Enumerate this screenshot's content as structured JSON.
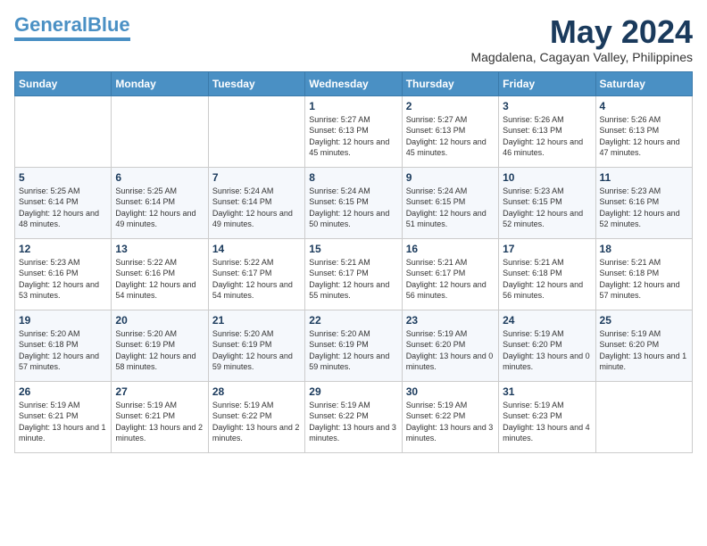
{
  "header": {
    "logo_general": "General",
    "logo_blue": "Blue",
    "month_year": "May 2024",
    "location": "Magdalena, Cagayan Valley, Philippines"
  },
  "weekdays": [
    "Sunday",
    "Monday",
    "Tuesday",
    "Wednesday",
    "Thursday",
    "Friday",
    "Saturday"
  ],
  "weeks": [
    [
      {
        "day": "",
        "info": ""
      },
      {
        "day": "",
        "info": ""
      },
      {
        "day": "",
        "info": ""
      },
      {
        "day": "1",
        "info": "Sunrise: 5:27 AM\nSunset: 6:13 PM\nDaylight: 12 hours\nand 45 minutes."
      },
      {
        "day": "2",
        "info": "Sunrise: 5:27 AM\nSunset: 6:13 PM\nDaylight: 12 hours\nand 45 minutes."
      },
      {
        "day": "3",
        "info": "Sunrise: 5:26 AM\nSunset: 6:13 PM\nDaylight: 12 hours\nand 46 minutes."
      },
      {
        "day": "4",
        "info": "Sunrise: 5:26 AM\nSunset: 6:13 PM\nDaylight: 12 hours\nand 47 minutes."
      }
    ],
    [
      {
        "day": "5",
        "info": "Sunrise: 5:25 AM\nSunset: 6:14 PM\nDaylight: 12 hours\nand 48 minutes."
      },
      {
        "day": "6",
        "info": "Sunrise: 5:25 AM\nSunset: 6:14 PM\nDaylight: 12 hours\nand 49 minutes."
      },
      {
        "day": "7",
        "info": "Sunrise: 5:24 AM\nSunset: 6:14 PM\nDaylight: 12 hours\nand 49 minutes."
      },
      {
        "day": "8",
        "info": "Sunrise: 5:24 AM\nSunset: 6:15 PM\nDaylight: 12 hours\nand 50 minutes."
      },
      {
        "day": "9",
        "info": "Sunrise: 5:24 AM\nSunset: 6:15 PM\nDaylight: 12 hours\nand 51 minutes."
      },
      {
        "day": "10",
        "info": "Sunrise: 5:23 AM\nSunset: 6:15 PM\nDaylight: 12 hours\nand 52 minutes."
      },
      {
        "day": "11",
        "info": "Sunrise: 5:23 AM\nSunset: 6:16 PM\nDaylight: 12 hours\nand 52 minutes."
      }
    ],
    [
      {
        "day": "12",
        "info": "Sunrise: 5:23 AM\nSunset: 6:16 PM\nDaylight: 12 hours\nand 53 minutes."
      },
      {
        "day": "13",
        "info": "Sunrise: 5:22 AM\nSunset: 6:16 PM\nDaylight: 12 hours\nand 54 minutes."
      },
      {
        "day": "14",
        "info": "Sunrise: 5:22 AM\nSunset: 6:17 PM\nDaylight: 12 hours\nand 54 minutes."
      },
      {
        "day": "15",
        "info": "Sunrise: 5:21 AM\nSunset: 6:17 PM\nDaylight: 12 hours\nand 55 minutes."
      },
      {
        "day": "16",
        "info": "Sunrise: 5:21 AM\nSunset: 6:17 PM\nDaylight: 12 hours\nand 56 minutes."
      },
      {
        "day": "17",
        "info": "Sunrise: 5:21 AM\nSunset: 6:18 PM\nDaylight: 12 hours\nand 56 minutes."
      },
      {
        "day": "18",
        "info": "Sunrise: 5:21 AM\nSunset: 6:18 PM\nDaylight: 12 hours\nand 57 minutes."
      }
    ],
    [
      {
        "day": "19",
        "info": "Sunrise: 5:20 AM\nSunset: 6:18 PM\nDaylight: 12 hours\nand 57 minutes."
      },
      {
        "day": "20",
        "info": "Sunrise: 5:20 AM\nSunset: 6:19 PM\nDaylight: 12 hours\nand 58 minutes."
      },
      {
        "day": "21",
        "info": "Sunrise: 5:20 AM\nSunset: 6:19 PM\nDaylight: 12 hours\nand 59 minutes."
      },
      {
        "day": "22",
        "info": "Sunrise: 5:20 AM\nSunset: 6:19 PM\nDaylight: 12 hours\nand 59 minutes."
      },
      {
        "day": "23",
        "info": "Sunrise: 5:19 AM\nSunset: 6:20 PM\nDaylight: 13 hours\nand 0 minutes."
      },
      {
        "day": "24",
        "info": "Sunrise: 5:19 AM\nSunset: 6:20 PM\nDaylight: 13 hours\nand 0 minutes."
      },
      {
        "day": "25",
        "info": "Sunrise: 5:19 AM\nSunset: 6:20 PM\nDaylight: 13 hours\nand 1 minute."
      }
    ],
    [
      {
        "day": "26",
        "info": "Sunrise: 5:19 AM\nSunset: 6:21 PM\nDaylight: 13 hours\nand 1 minute."
      },
      {
        "day": "27",
        "info": "Sunrise: 5:19 AM\nSunset: 6:21 PM\nDaylight: 13 hours\nand 2 minutes."
      },
      {
        "day": "28",
        "info": "Sunrise: 5:19 AM\nSunset: 6:22 PM\nDaylight: 13 hours\nand 2 minutes."
      },
      {
        "day": "29",
        "info": "Sunrise: 5:19 AM\nSunset: 6:22 PM\nDaylight: 13 hours\nand 3 minutes."
      },
      {
        "day": "30",
        "info": "Sunrise: 5:19 AM\nSunset: 6:22 PM\nDaylight: 13 hours\nand 3 minutes."
      },
      {
        "day": "31",
        "info": "Sunrise: 5:19 AM\nSunset: 6:23 PM\nDaylight: 13 hours\nand 4 minutes."
      },
      {
        "day": "",
        "info": ""
      }
    ]
  ]
}
